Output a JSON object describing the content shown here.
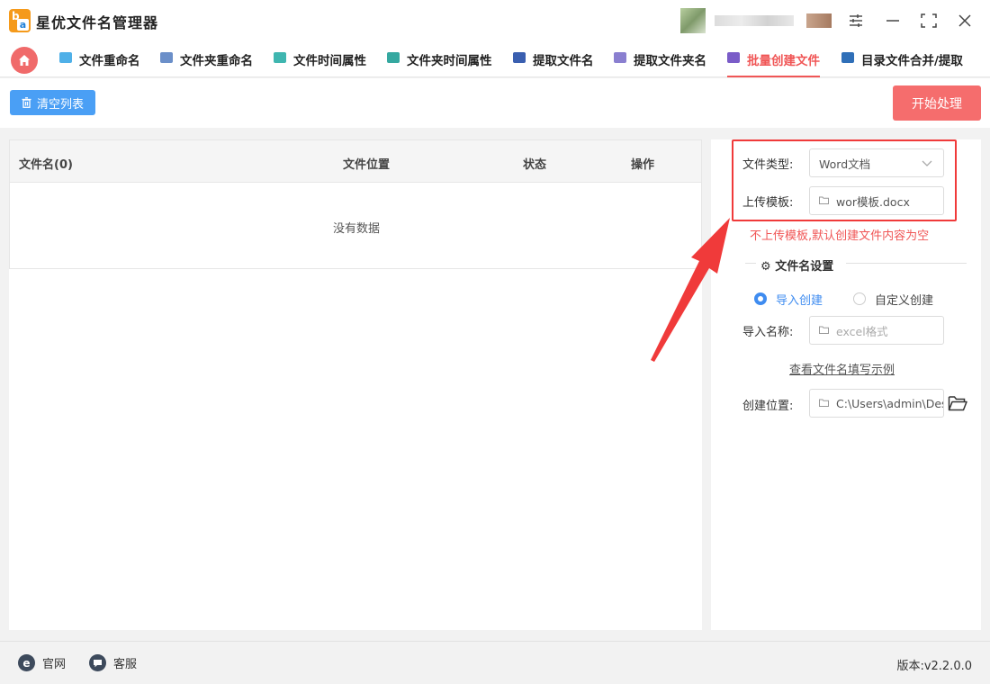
{
  "window": {
    "title": "星优文件名管理器",
    "controls": [
      "settings-icon",
      "minimize-icon",
      "maximize-icon",
      "close-icon"
    ]
  },
  "tabs": [
    {
      "label": "文件重命名",
      "icon_color": "#4fb0e8"
    },
    {
      "label": "文件夹重命名",
      "icon_color": "#6b8fc9"
    },
    {
      "label": "文件时间属性",
      "icon_color": "#3fb6b0"
    },
    {
      "label": "文件夹时间属性",
      "icon_color": "#35a8a0"
    },
    {
      "label": "提取文件名",
      "icon_color": "#3a5fb0"
    },
    {
      "label": "提取文件夹名",
      "icon_color": "#8a7fd0"
    },
    {
      "label": "批量创建文件",
      "icon_color": "#7a5cc8",
      "active": true
    },
    {
      "label": "目录文件合并/提取",
      "icon_color": "#2f6fb8"
    }
  ],
  "toolbar": {
    "clear_label": "清空列表",
    "start_label": "开始处理"
  },
  "table": {
    "columns": [
      "文件名(0)",
      "文件位置",
      "状态",
      "操作"
    ],
    "empty_text": "没有数据"
  },
  "settings": {
    "file_type_label": "文件类型:",
    "file_type_value": "Word文档",
    "template_label": "上传模板:",
    "template_value": "wor模板.docx",
    "hint": "不上传模板,默认创建文件内容为空",
    "section_title": "文件名设置",
    "radio_import": "导入创建",
    "radio_custom": "自定义创建",
    "import_name_label": "导入名称:",
    "import_name_placeholder": "excel格式",
    "example_link": "查看文件名填写示例",
    "location_label": "创建位置:",
    "location_value": "C:\\Users\\admin\\Des"
  },
  "footer": {
    "website_label": "官网",
    "support_label": "客服",
    "version": "版本:v2.2.0.0"
  },
  "colors": {
    "accent_red": "#f05656",
    "accent_blue": "#4a9ff5",
    "annotation_red": "#f03a3a"
  }
}
